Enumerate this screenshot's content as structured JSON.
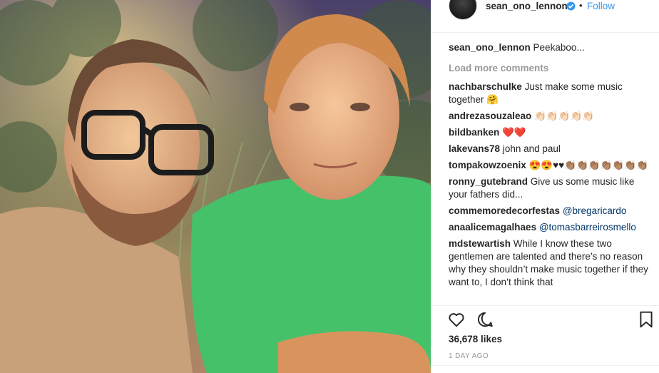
{
  "post": {
    "username": "sean_ono_lennon",
    "follow_label": "Follow",
    "dot": "•",
    "caption_text": "Peekaboo...",
    "load_more": "Load more comments",
    "likes": "36,678 likes",
    "time": "1 DAY AGO"
  },
  "comments": [
    {
      "user": "nachbarschulke",
      "text": "Just make some music together 🤗"
    },
    {
      "user": "andrezasouzaleao",
      "text": "👏🏻👏🏻👏🏻👏🏻👏🏻"
    },
    {
      "user": "bildbanken",
      "text": "❤️❤️"
    },
    {
      "user": "lakevans78",
      "text": "john and paul"
    },
    {
      "user": "tompakowzoenix",
      "text": "😍😍♥♥👏🏽👏🏽👏🏽👏🏽👏🏽👏🏽👏🏽"
    },
    {
      "user": "ronny_gutebrand",
      "text": "Give us some music like your fathers did..."
    },
    {
      "user": "commemoredecorfestas",
      "mention": "@bregaricardo"
    },
    {
      "user": "anaalicemagalhaes",
      "mention": "@tomasbarreirosmello"
    },
    {
      "user": "mdstewartish",
      "text": "While I know these two gentlemen are talented and there’s no reason why they shouldn’t make music together if they want to, I don’t think that"
    }
  ],
  "icons": {
    "heart": "heart-icon",
    "comment": "comment-icon",
    "bookmark": "bookmark-icon",
    "verified": "verified-badge-icon"
  },
  "colors": {
    "link_blue": "#3897f0",
    "mention_blue": "#003569",
    "muted": "#999999",
    "text": "#262626"
  }
}
